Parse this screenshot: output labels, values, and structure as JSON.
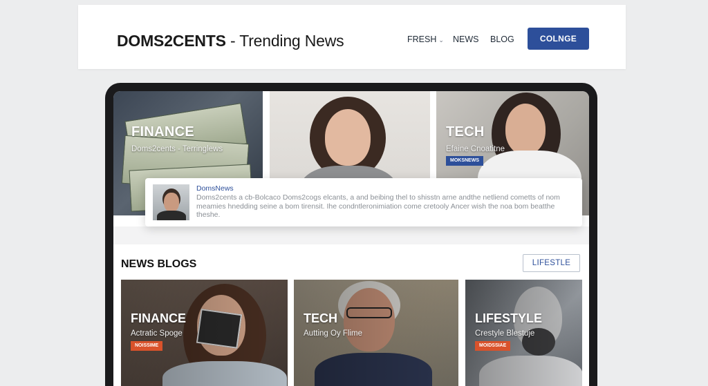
{
  "header": {
    "brand": "DOMS2CENTS",
    "separator": "-",
    "tagline": "Trending News",
    "nav": {
      "fresh": "FRESH",
      "news": "NEWS",
      "blog": "BLOG"
    },
    "cta_label": "COLNGE"
  },
  "hero": {
    "tiles": [
      {
        "title": "FINANCE",
        "subtitle": "Doms2cents - Terringlews"
      },
      {
        "title": "",
        "subtitle": ""
      },
      {
        "title": "TECH",
        "subtitle": "Efaine Cnoatitne",
        "badge": "MOKSNEWS"
      }
    ]
  },
  "comment": {
    "author": "DomsNews",
    "text": "Doms2cents a cb-Bolcaco Doms2cogs elcants, a and beibing thel to shisstn arne andthe netliend cometts of nom meamies hnedding seine a bom tirensit. Ihe condntleronimiation come cretooly Ancer wish the noa bom beatthe theshe."
  },
  "news_section": {
    "title": "NEWS BLOGS",
    "filter_button": "LIFESTLE",
    "cards": [
      {
        "title": "FINANCE",
        "subtitle": "Actratic Spoge",
        "badge": "NOISSIME"
      },
      {
        "title": "TECH",
        "subtitle": "Autting Oy Flime",
        "badge": ""
      },
      {
        "title": "LIFESTYLE",
        "subtitle": "Crestyle Blestuje",
        "badge": "MOIDSSIAE"
      }
    ]
  },
  "colors": {
    "page_bg": "#ecedee",
    "accent_blue": "#2d4f9a",
    "badge_orange": "#d9522b",
    "device_frame": "#1a1a1c"
  }
}
